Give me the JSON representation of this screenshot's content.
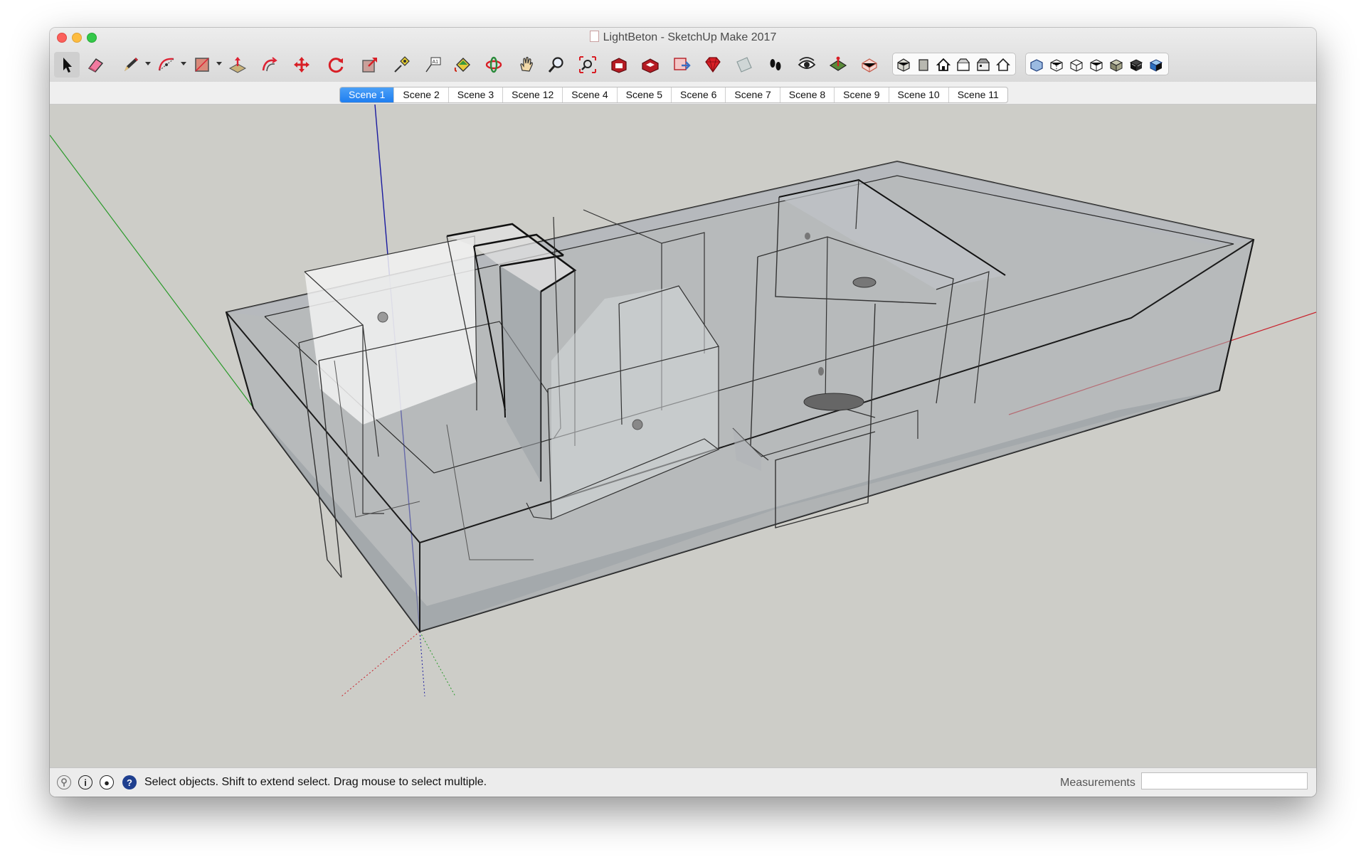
{
  "window": {
    "title": "LightBeton - SketchUp Make 2017"
  },
  "toolbar": {
    "tools": [
      {
        "name": "select",
        "icon": "arrow-cursor-icon"
      },
      {
        "name": "eraser",
        "icon": "eraser-icon"
      },
      {
        "name": "line",
        "icon": "pencil-icon"
      },
      {
        "name": "arc",
        "icon": "arc-icon"
      },
      {
        "name": "rectangle",
        "icon": "rectangle-icon"
      },
      {
        "name": "push-pull",
        "icon": "push-pull-icon"
      },
      {
        "name": "offset",
        "icon": "offset-icon"
      },
      {
        "name": "move",
        "icon": "move-arrows-icon"
      },
      {
        "name": "rotate",
        "icon": "rotate-icon"
      },
      {
        "name": "scale",
        "icon": "scale-icon"
      },
      {
        "name": "tape-measure",
        "icon": "tape-measure-icon"
      },
      {
        "name": "text",
        "icon": "text-label-icon"
      },
      {
        "name": "paint-bucket",
        "icon": "paint-bucket-icon"
      },
      {
        "name": "orbit",
        "icon": "orbit-icon"
      },
      {
        "name": "pan",
        "icon": "hand-icon"
      },
      {
        "name": "zoom",
        "icon": "magnifier-icon"
      },
      {
        "name": "zoom-extents",
        "icon": "zoom-extents-icon"
      },
      {
        "name": "3d-warehouse",
        "icon": "warehouse-icon"
      },
      {
        "name": "share-model",
        "icon": "share-model-icon"
      },
      {
        "name": "extension-warehouse",
        "icon": "extension-warehouse-icon"
      },
      {
        "name": "ruby",
        "icon": "ruby-icon"
      },
      {
        "name": "section-plane",
        "icon": "section-plane-icon"
      },
      {
        "name": "walk",
        "icon": "footprints-icon"
      },
      {
        "name": "look-around",
        "icon": "eye-icon"
      },
      {
        "name": "position-camera",
        "icon": "position-camera-icon"
      },
      {
        "name": "sandbox",
        "icon": "sandbox-icon"
      }
    ],
    "views": [
      "iso-view-icon",
      "top-view-icon",
      "front-view-icon",
      "right-view-icon",
      "back-view-icon",
      "left-view-icon"
    ],
    "styles": [
      "xray-style-icon",
      "back-edges-style-icon",
      "wireframe-style-icon",
      "hidden-line-style-icon",
      "shaded-style-icon",
      "shaded-textures-style-icon",
      "monochrome-style-icon"
    ]
  },
  "scenes": {
    "active": "Scene 1",
    "tabs": [
      "Scene 1",
      "Scene 2",
      "Scene 3",
      "Scene 12",
      "Scene 4",
      "Scene 5",
      "Scene 6",
      "Scene 7",
      "Scene 8",
      "Scene 9",
      "Scene 10",
      "Scene 11"
    ]
  },
  "status": {
    "hint": "Select objects. Shift to extend select. Drag mouse to select multiple.",
    "icons": [
      "geo-location-icon",
      "credits-icon",
      "user-account-icon",
      "help-icon"
    ]
  },
  "measurements": {
    "label": "Measurements",
    "value": ""
  },
  "colors": {
    "axis_red": "#c8202a",
    "axis_green": "#2a9a2a",
    "axis_blue": "#1a1aa0",
    "viewport_bg": "#cdcdc8",
    "scene_active": "#2a83f2"
  }
}
